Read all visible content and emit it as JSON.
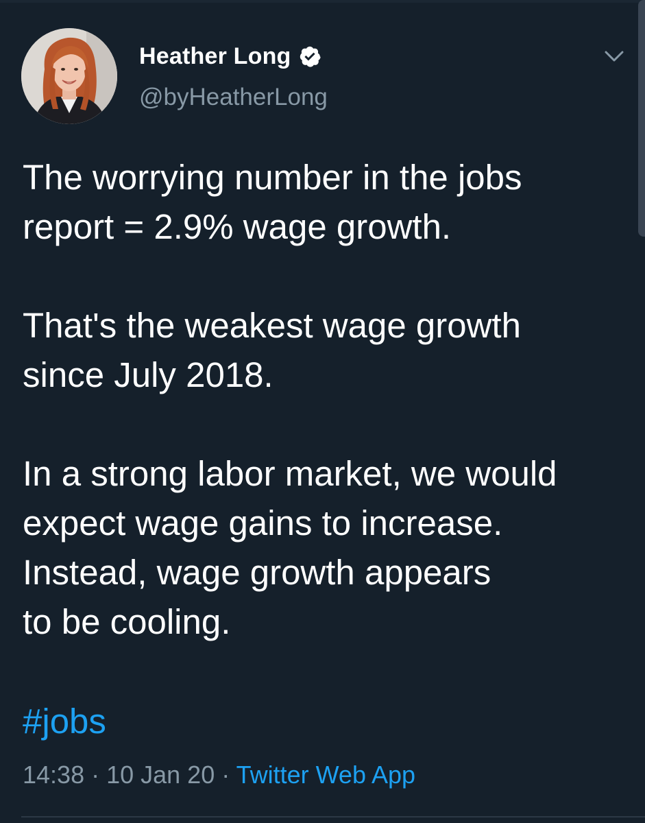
{
  "author": {
    "display_name": "Heather Long",
    "handle": "@byHeatherLong",
    "verified": true,
    "verified_icon": "verified-badge-icon",
    "avatar": "profile-photo"
  },
  "menu_icon": "chevron-down-icon",
  "tweet": {
    "paragraph_1": "The worrying number in the jobs\nreport = 2.9% wage growth.",
    "paragraph_2": "That's the weakest wage growth\nsince July 2018.",
    "paragraph_3": "In a strong labor market, we would\nexpect wage gains to increase.\nInstead, wage growth appears\nto be cooling.",
    "hashtag": "#jobs"
  },
  "meta": {
    "time": "14:38",
    "separator": " · ",
    "date": "10 Jan 20",
    "source": "Twitter Web App"
  },
  "colors": {
    "background": "#15202b",
    "text": "#ffffff",
    "secondary_text": "#8899a6",
    "link": "#1da1f2"
  }
}
